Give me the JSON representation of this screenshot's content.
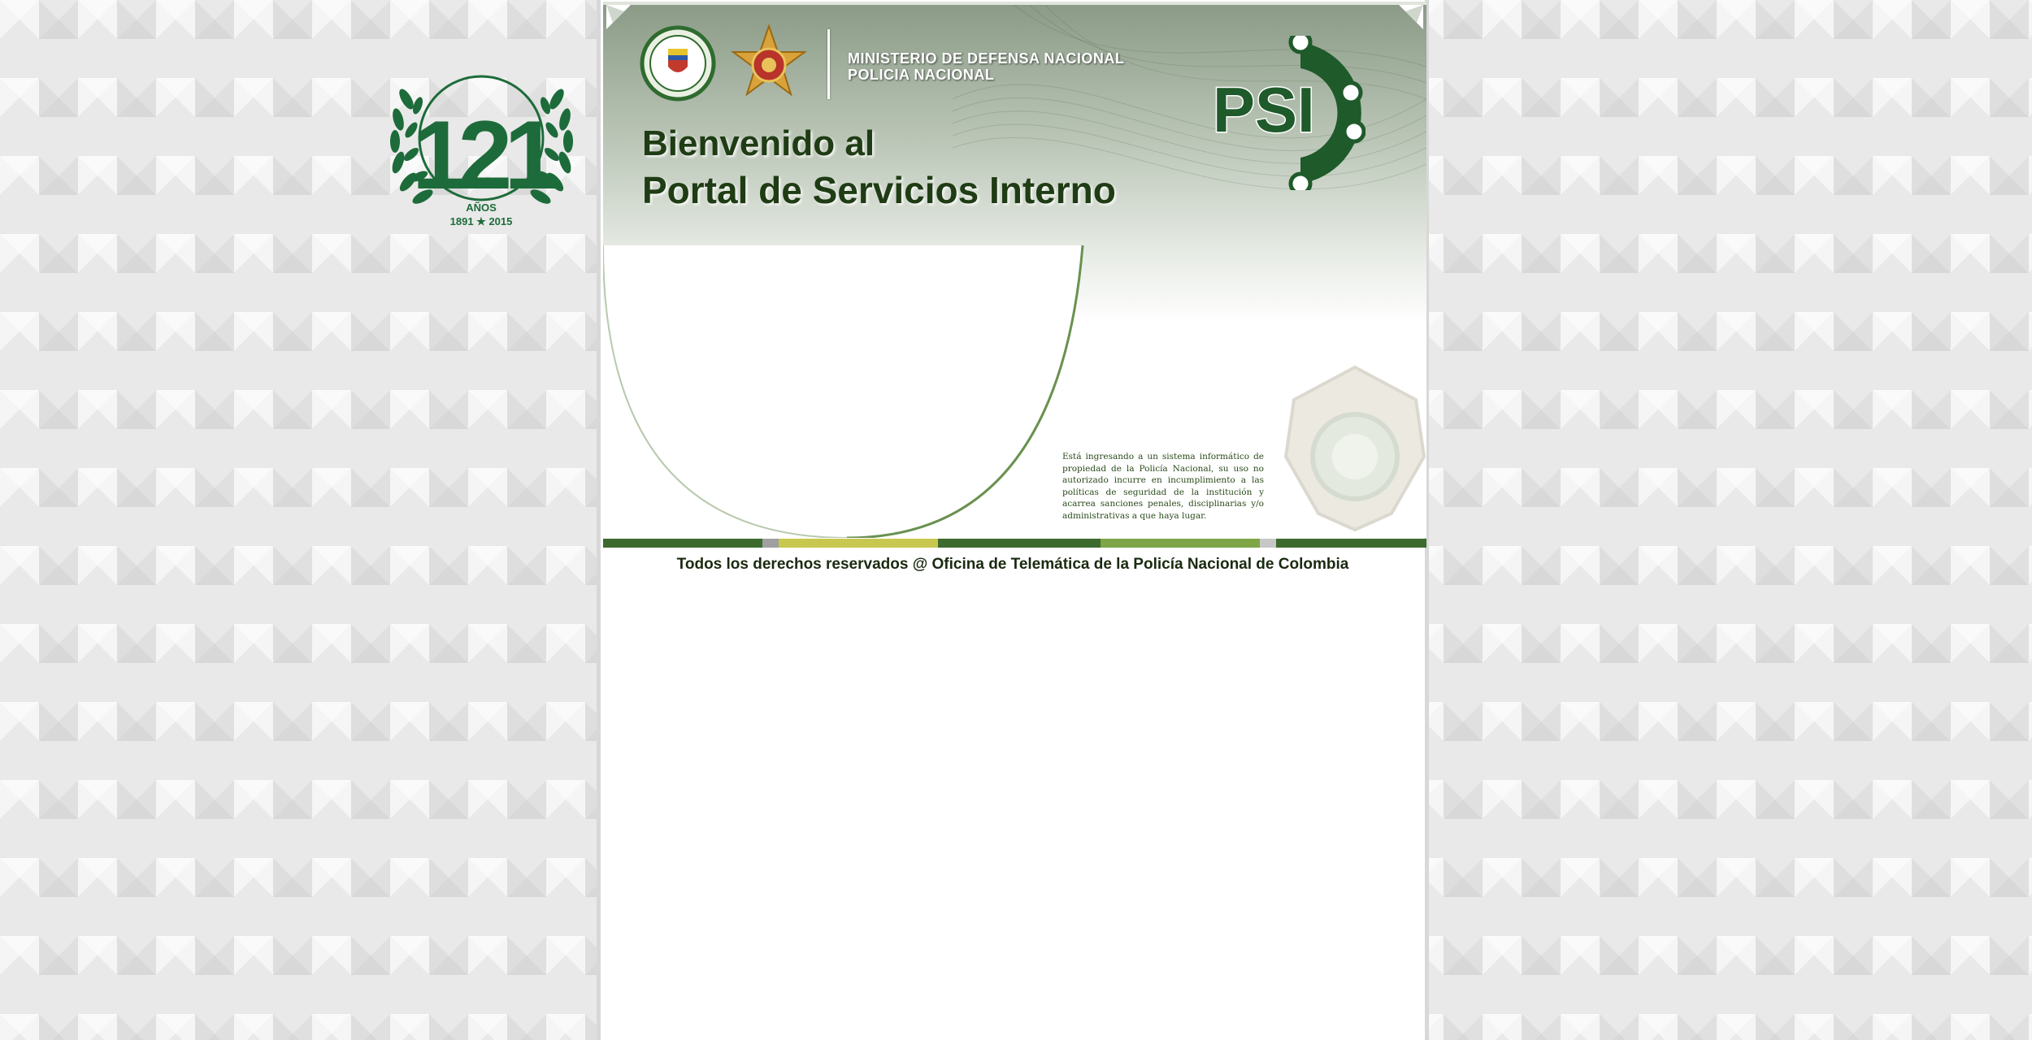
{
  "emblem": {
    "number": "121",
    "anos_label": "AÑOS",
    "years": "1891 ★ 2015"
  },
  "header": {
    "ministry_line1": "MINISTERIO DE DEFENSA NACIONAL",
    "ministry_line2": "POLICIA NACIONAL",
    "welcome_line1": "Bienvenido al",
    "welcome_line2": "Portal de Servicios Interno",
    "logo_text": "PSI"
  },
  "notice": {
    "text": "Está ingresando a un sistema informático de propiedad de la Policía Nacional, su uso no autorizado incurre en incumplimiento a las políticas de seguridad de la institución y acarrea sanciones penales, disciplinarias y/o administrativas a que haya lugar."
  },
  "footer": {
    "copyright": "Todos los derechos reservados @ Oficina de Telemática de la Policía Nacional de Colombia"
  },
  "colors": {
    "brand_green": "#1f5a2a",
    "dark_green": "#1f3c14",
    "strip": [
      "#3d6b2e",
      "#a0a0a0",
      "#c8c850",
      "#3d6b2e",
      "#7ea646",
      "#c7c7c7",
      "#3d6b2e"
    ]
  }
}
